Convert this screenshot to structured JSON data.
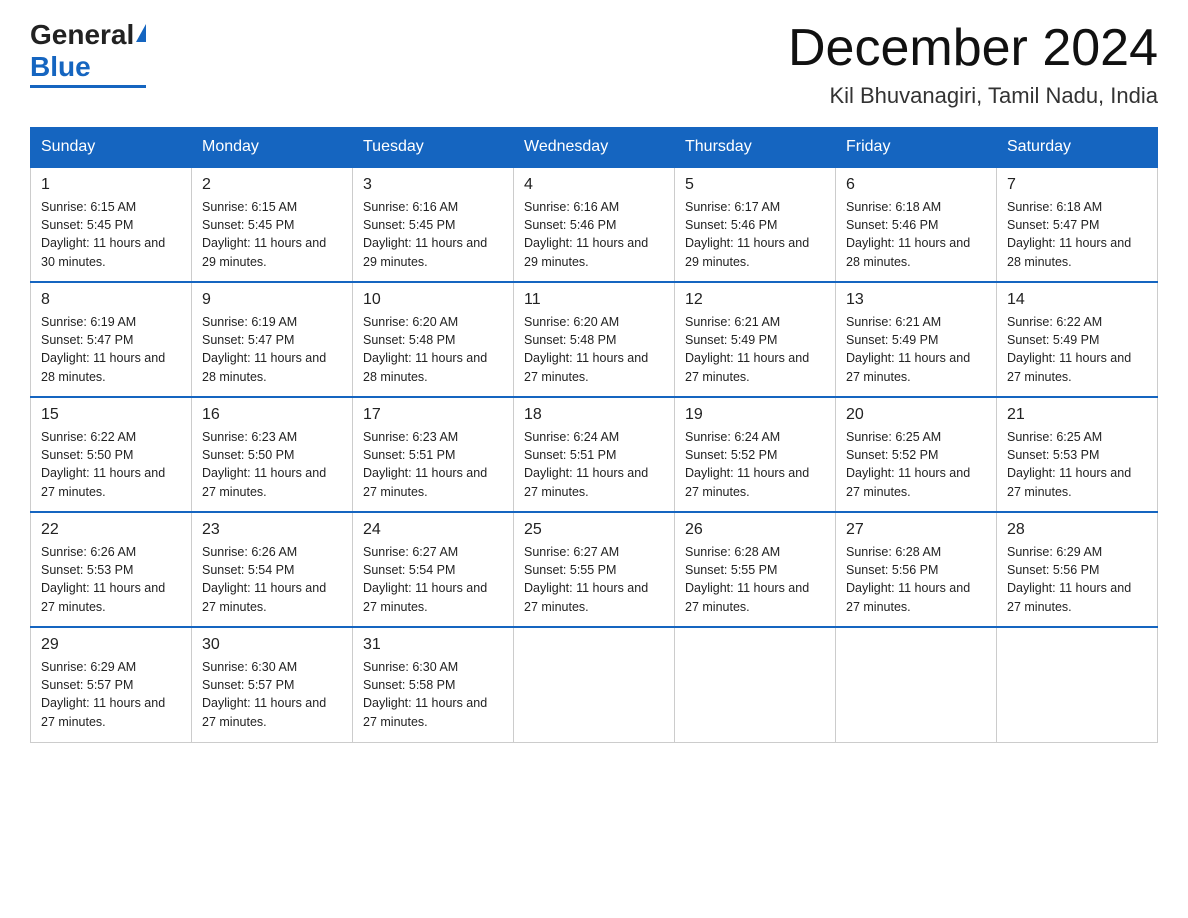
{
  "logo": {
    "general": "General",
    "blue": "Blue",
    "url_text": "GeneralBlue"
  },
  "title": "December 2024",
  "subtitle": "Kil Bhuvanagiri, Tamil Nadu, India",
  "days_of_week": [
    "Sunday",
    "Monday",
    "Tuesday",
    "Wednesday",
    "Thursday",
    "Friday",
    "Saturday"
  ],
  "weeks": [
    [
      {
        "day": "1",
        "sunrise": "6:15 AM",
        "sunset": "5:45 PM",
        "daylight": "11 hours and 30 minutes."
      },
      {
        "day": "2",
        "sunrise": "6:15 AM",
        "sunset": "5:45 PM",
        "daylight": "11 hours and 29 minutes."
      },
      {
        "day": "3",
        "sunrise": "6:16 AM",
        "sunset": "5:45 PM",
        "daylight": "11 hours and 29 minutes."
      },
      {
        "day": "4",
        "sunrise": "6:16 AM",
        "sunset": "5:46 PM",
        "daylight": "11 hours and 29 minutes."
      },
      {
        "day": "5",
        "sunrise": "6:17 AM",
        "sunset": "5:46 PM",
        "daylight": "11 hours and 29 minutes."
      },
      {
        "day": "6",
        "sunrise": "6:18 AM",
        "sunset": "5:46 PM",
        "daylight": "11 hours and 28 minutes."
      },
      {
        "day": "7",
        "sunrise": "6:18 AM",
        "sunset": "5:47 PM",
        "daylight": "11 hours and 28 minutes."
      }
    ],
    [
      {
        "day": "8",
        "sunrise": "6:19 AM",
        "sunset": "5:47 PM",
        "daylight": "11 hours and 28 minutes."
      },
      {
        "day": "9",
        "sunrise": "6:19 AM",
        "sunset": "5:47 PM",
        "daylight": "11 hours and 28 minutes."
      },
      {
        "day": "10",
        "sunrise": "6:20 AM",
        "sunset": "5:48 PM",
        "daylight": "11 hours and 28 minutes."
      },
      {
        "day": "11",
        "sunrise": "6:20 AM",
        "sunset": "5:48 PM",
        "daylight": "11 hours and 27 minutes."
      },
      {
        "day": "12",
        "sunrise": "6:21 AM",
        "sunset": "5:49 PM",
        "daylight": "11 hours and 27 minutes."
      },
      {
        "day": "13",
        "sunrise": "6:21 AM",
        "sunset": "5:49 PM",
        "daylight": "11 hours and 27 minutes."
      },
      {
        "day": "14",
        "sunrise": "6:22 AM",
        "sunset": "5:49 PM",
        "daylight": "11 hours and 27 minutes."
      }
    ],
    [
      {
        "day": "15",
        "sunrise": "6:22 AM",
        "sunset": "5:50 PM",
        "daylight": "11 hours and 27 minutes."
      },
      {
        "day": "16",
        "sunrise": "6:23 AM",
        "sunset": "5:50 PM",
        "daylight": "11 hours and 27 minutes."
      },
      {
        "day": "17",
        "sunrise": "6:23 AM",
        "sunset": "5:51 PM",
        "daylight": "11 hours and 27 minutes."
      },
      {
        "day": "18",
        "sunrise": "6:24 AM",
        "sunset": "5:51 PM",
        "daylight": "11 hours and 27 minutes."
      },
      {
        "day": "19",
        "sunrise": "6:24 AM",
        "sunset": "5:52 PM",
        "daylight": "11 hours and 27 minutes."
      },
      {
        "day": "20",
        "sunrise": "6:25 AM",
        "sunset": "5:52 PM",
        "daylight": "11 hours and 27 minutes."
      },
      {
        "day": "21",
        "sunrise": "6:25 AM",
        "sunset": "5:53 PM",
        "daylight": "11 hours and 27 minutes."
      }
    ],
    [
      {
        "day": "22",
        "sunrise": "6:26 AM",
        "sunset": "5:53 PM",
        "daylight": "11 hours and 27 minutes."
      },
      {
        "day": "23",
        "sunrise": "6:26 AM",
        "sunset": "5:54 PM",
        "daylight": "11 hours and 27 minutes."
      },
      {
        "day": "24",
        "sunrise": "6:27 AM",
        "sunset": "5:54 PM",
        "daylight": "11 hours and 27 minutes."
      },
      {
        "day": "25",
        "sunrise": "6:27 AM",
        "sunset": "5:55 PM",
        "daylight": "11 hours and 27 minutes."
      },
      {
        "day": "26",
        "sunrise": "6:28 AM",
        "sunset": "5:55 PM",
        "daylight": "11 hours and 27 minutes."
      },
      {
        "day": "27",
        "sunrise": "6:28 AM",
        "sunset": "5:56 PM",
        "daylight": "11 hours and 27 minutes."
      },
      {
        "day": "28",
        "sunrise": "6:29 AM",
        "sunset": "5:56 PM",
        "daylight": "11 hours and 27 minutes."
      }
    ],
    [
      {
        "day": "29",
        "sunrise": "6:29 AM",
        "sunset": "5:57 PM",
        "daylight": "11 hours and 27 minutes."
      },
      {
        "day": "30",
        "sunrise": "6:30 AM",
        "sunset": "5:57 PM",
        "daylight": "11 hours and 27 minutes."
      },
      {
        "day": "31",
        "sunrise": "6:30 AM",
        "sunset": "5:58 PM",
        "daylight": "11 hours and 27 minutes."
      },
      null,
      null,
      null,
      null
    ]
  ]
}
